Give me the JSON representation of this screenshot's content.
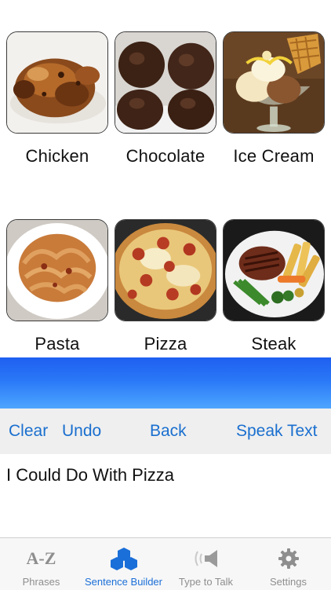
{
  "tiles": [
    {
      "label": "Chicken"
    },
    {
      "label": "Chocolate"
    },
    {
      "label": "Ice Cream"
    },
    {
      "label": "Pasta"
    },
    {
      "label": "Pizza"
    },
    {
      "label": "Steak"
    }
  ],
  "actions": {
    "clear": "Clear",
    "undo": "Undo",
    "back": "Back",
    "speak": "Speak Text"
  },
  "sentence": {
    "text": "I Could Do With Pizza"
  },
  "tabs": [
    {
      "label": "Phrases",
      "icon_text": "A-Z",
      "icon": "a-z-icon"
    },
    {
      "label": "Sentence Builder",
      "icon": "cubes-icon",
      "active": true
    },
    {
      "label": "Type to Talk",
      "icon": "speaker-icon"
    },
    {
      "label": "Settings",
      "icon": "gear-icon"
    }
  ],
  "colors": {
    "accent": "#1b6fd8",
    "band_top": "#1e5ff0",
    "band_bottom": "#4da6ff",
    "action_bg": "#efefef"
  }
}
